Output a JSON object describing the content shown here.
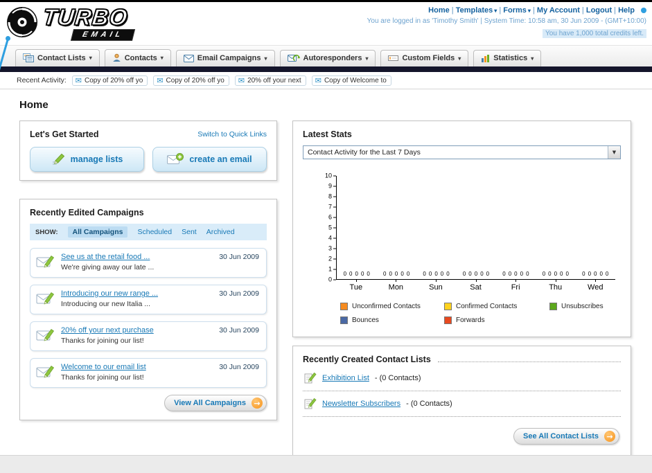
{
  "brand": {
    "name_top": "TURBO",
    "name_bottom": "EMAIL"
  },
  "header": {
    "links": [
      {
        "label": "Home",
        "has_dropdown": false
      },
      {
        "label": "Templates",
        "has_dropdown": true
      },
      {
        "label": "Forms",
        "has_dropdown": true
      },
      {
        "label": "My Account",
        "has_dropdown": false
      },
      {
        "label": "Logout",
        "has_dropdown": false
      },
      {
        "label": "Help",
        "has_dropdown": false
      }
    ],
    "status_line": "You are logged in as 'Timothy Smith' | System Time: 10:58 am, 30 Jun 2009 - (GMT+10:00)",
    "credits_line": "You have 1,000 total credits left."
  },
  "main_nav": {
    "items": [
      {
        "label": "Contact Lists",
        "icon": "contact-lists-icon"
      },
      {
        "label": "Contacts",
        "icon": "contacts-icon"
      },
      {
        "label": "Email Campaigns",
        "icon": "email-campaigns-icon"
      },
      {
        "label": "Autoresponders",
        "icon": "autoresponders-icon"
      },
      {
        "label": "Custom Fields",
        "icon": "custom-fields-icon"
      },
      {
        "label": "Statistics",
        "icon": "statistics-icon"
      }
    ]
  },
  "recent_activity": {
    "label": "Recent Activity:",
    "items": [
      "Copy of 20% off yo",
      "Copy of 20% off yo",
      "20% off your next",
      "Copy of Welcome to"
    ]
  },
  "page": {
    "title": "Home"
  },
  "get_started": {
    "title": "Let's Get Started",
    "switch_link": "Switch to Quick Links",
    "manage_lists_label": "manage lists",
    "create_email_label": "create an email"
  },
  "campaigns": {
    "title": "Recently Edited Campaigns",
    "show_label": "SHOW:",
    "tabs": [
      "All Campaigns",
      "Scheduled",
      "Sent",
      "Archived"
    ],
    "selected_tab": "All Campaigns",
    "items": [
      {
        "title": "See us at the retail food ...",
        "subtitle": "We're giving away our late ...",
        "date": "30 Jun 2009"
      },
      {
        "title": "Introducing our new range ...",
        "subtitle": "Introducing our new Italia ...",
        "date": "30 Jun 2009"
      },
      {
        "title": "20% off your next purchase",
        "subtitle": "Thanks for joining our list!",
        "date": "30 Jun 2009"
      },
      {
        "title": "Welcome to our email list",
        "subtitle": "Thanks for joining our list!",
        "date": "30 Jun 2009"
      }
    ],
    "view_all_label": "View All Campaigns"
  },
  "stats": {
    "title": "Latest Stats",
    "period_selected": "Contact Activity for the Last 7 Days"
  },
  "chart_data": {
    "type": "bar",
    "title": "Contact Activity for the Last 7 Days",
    "categories": [
      "Tue",
      "Mon",
      "Sun",
      "Sat",
      "Fri",
      "Thu",
      "Wed"
    ],
    "series": [
      {
        "name": "Unconfirmed Contacts",
        "color": "#f68b1f",
        "values": [
          0,
          0,
          0,
          0,
          0,
          0,
          0
        ]
      },
      {
        "name": "Confirmed Contacts",
        "color": "#ffd21e",
        "values": [
          0,
          0,
          0,
          0,
          0,
          0,
          0
        ]
      },
      {
        "name": "Unsubscribes",
        "color": "#5ca81c",
        "values": [
          0,
          0,
          0,
          0,
          0,
          0,
          0
        ]
      },
      {
        "name": "Bounces",
        "color": "#4a69a5",
        "values": [
          0,
          0,
          0,
          0,
          0,
          0,
          0
        ]
      },
      {
        "name": "Forwards",
        "color": "#e8491f",
        "values": [
          0,
          0,
          0,
          0,
          0,
          0,
          0
        ]
      }
    ],
    "ylim": [
      0,
      10
    ],
    "ytick_step": 1,
    "grid": false,
    "legend_position": "bottom",
    "value_labels_shown": true
  },
  "contact_lists": {
    "title": "Recently Created Contact Lists",
    "items": [
      {
        "name": "Exhibition List",
        "detail": "- (0 Contacts)"
      },
      {
        "name": "Newsletter Subscribers",
        "detail": "- (0 Contacts)"
      }
    ],
    "see_all_label": "See All Contact Lists"
  }
}
